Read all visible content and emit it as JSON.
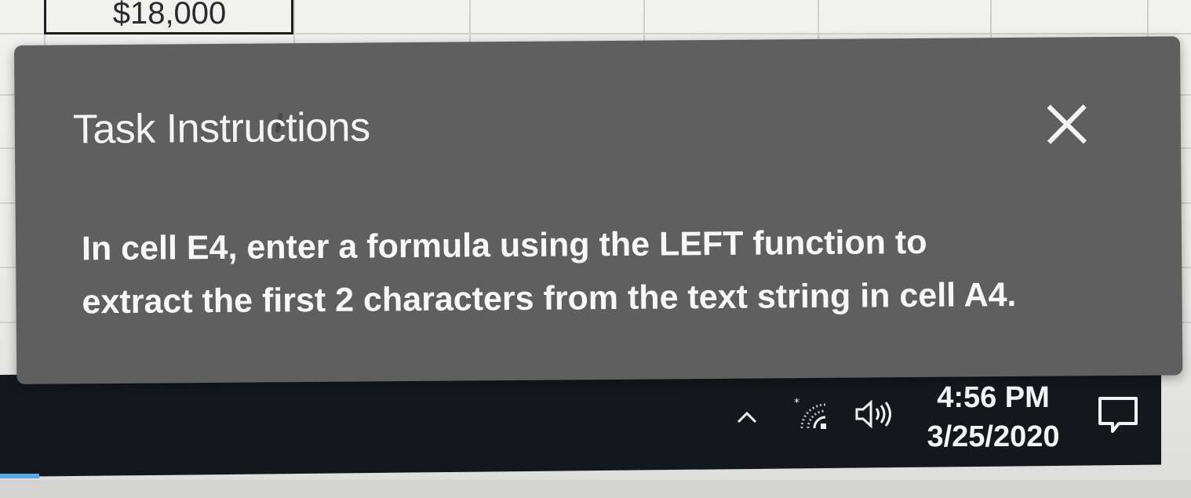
{
  "spreadsheet": {
    "visible_cell_value": "$18,000"
  },
  "dialog": {
    "title": "Task Instructions",
    "close_label": "×",
    "instruction_line1": "In cell E4, enter a formula using the LEFT function to",
    "instruction_line2": "extract the first 2 characters from the text string in cell A4."
  },
  "taskbar": {
    "time": "4:56 PM",
    "date": "3/25/2020",
    "icons": [
      "chevron-up-icon",
      "wifi-icon",
      "volume-icon",
      "notification-icon"
    ]
  },
  "colors": {
    "dialog_bg": "#5f5f5f",
    "taskbar_bg": "#14181d",
    "text": "#f4f4f4"
  }
}
